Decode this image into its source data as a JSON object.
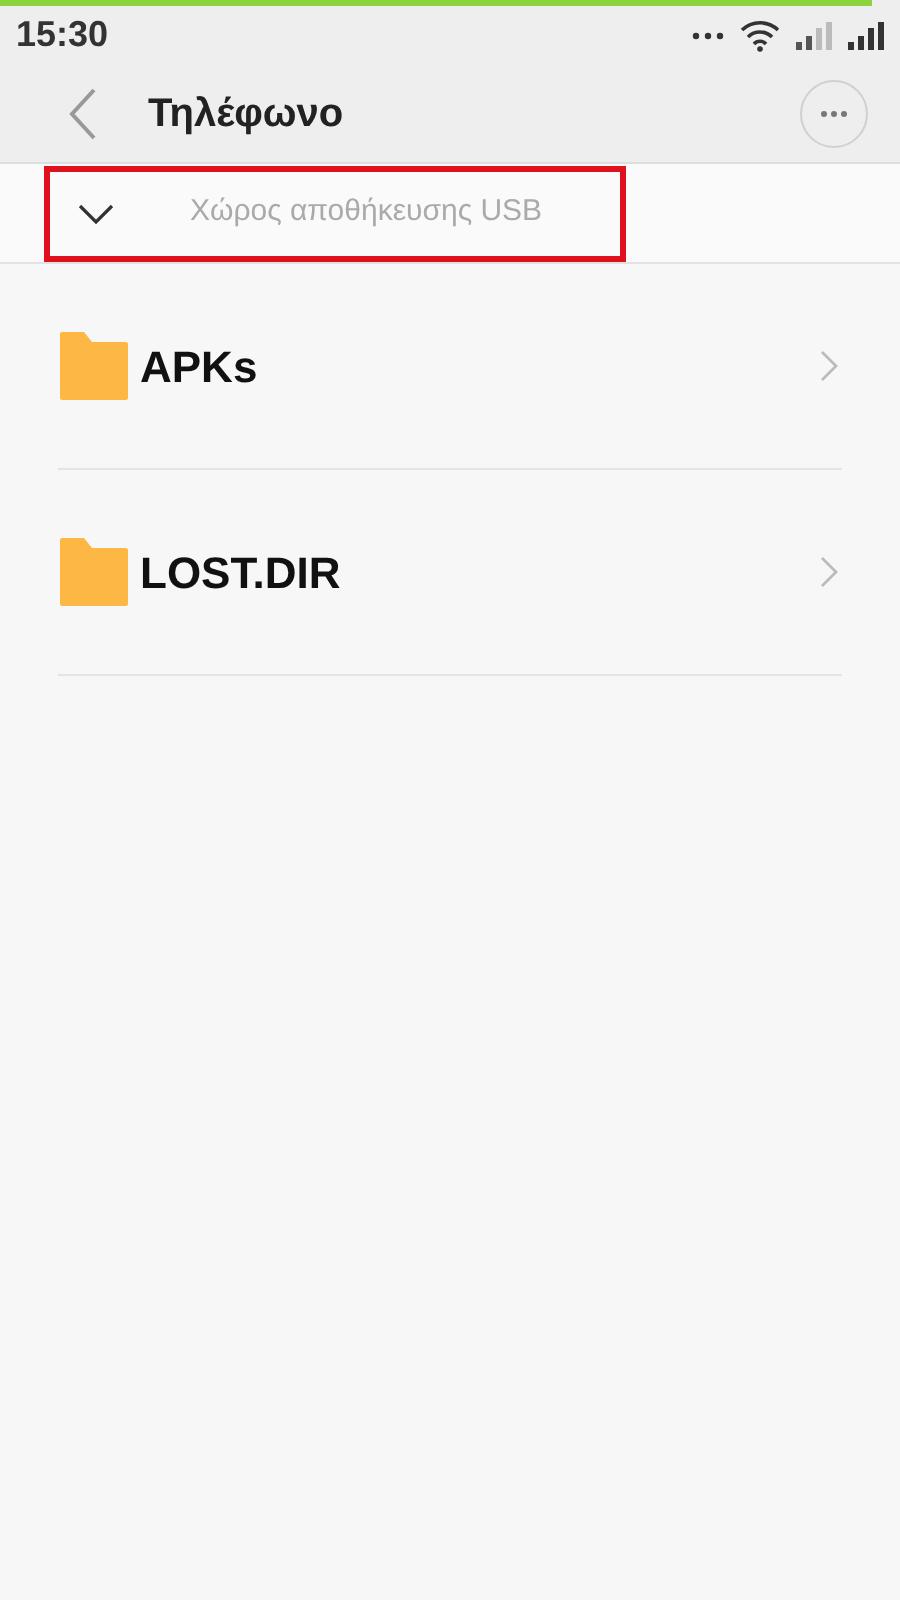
{
  "status_bar": {
    "time": "15:30"
  },
  "header": {
    "title": "Τηλέφωνο"
  },
  "storage_selector": {
    "label": "Χώρος αποθήκευσης USB",
    "highlighted": true
  },
  "folders": [
    {
      "name": "APKs"
    },
    {
      "name": "LOST.DIR"
    }
  ]
}
